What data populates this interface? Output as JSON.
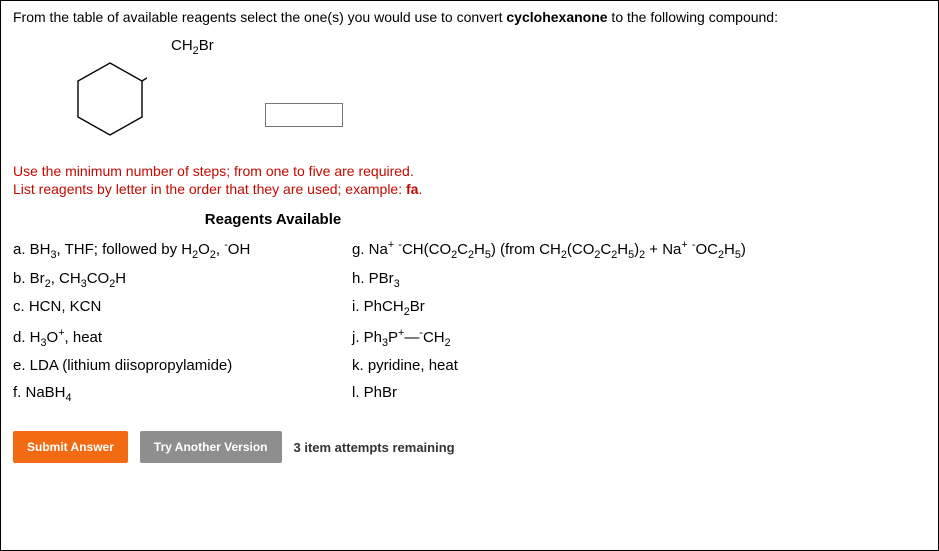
{
  "question": {
    "prefix": "From the table of available reagents select the one(s) you would use to convert ",
    "compound": "cyclohexanone",
    "suffix": " to the following compound:"
  },
  "structure": {
    "label_html": "CH<sub>2</sub>Br"
  },
  "instructions": {
    "line1": "Use the minimum number of steps; from one to five are required.",
    "line2_prefix": "List reagents by letter in the order that they are used; example: ",
    "line2_example": "fa",
    "line2_suffix": "."
  },
  "reagents": {
    "header": "Reagents Available",
    "left": [
      "a. BH<sub>3</sub>, THF; followed by H<sub>2</sub>O<sub>2</sub>, <sup>-</sup>OH",
      "b. Br<sub>2</sub>, CH<sub>3</sub>CO<sub>2</sub>H",
      "c. HCN, KCN",
      "d. H<sub>3</sub>O<sup>+</sup>, heat",
      "e. LDA (lithium diisopropylamide)",
      "f. NaBH<sub>4</sub>"
    ],
    "right": [
      "g. Na<sup>+</sup> <sup>-</sup>CH(CO<sub>2</sub>C<sub>2</sub>H<sub>5</sub>) (from CH<sub>2</sub>(CO<sub>2</sub>C<sub>2</sub>H<sub>5</sub>)<sub>2</sub> + Na<sup>+</sup> <sup>-</sup>OC<sub>2</sub>H<sub>5</sub>)",
      "h. PBr<sub>3</sub>",
      "i. PhCH<sub>2</sub>Br",
      "j. Ph<sub>3</sub>P<sup>+</sup>—<sup>-</sup>CH<sub>2</sub>",
      "k. pyridine, heat",
      "l. PhBr"
    ]
  },
  "buttons": {
    "submit": "Submit Answer",
    "try": "Try Another Version"
  },
  "attempts": "3 item attempts remaining"
}
